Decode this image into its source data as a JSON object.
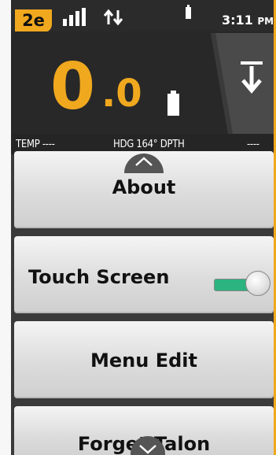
{
  "status": {
    "mode_badge": "2e",
    "time": "3:11",
    "ampm": "PM",
    "icons": [
      "signal-icon",
      "transfer-icon",
      "battery-icon"
    ]
  },
  "speed": {
    "integer": "0",
    "decimal": ".0"
  },
  "readings": {
    "temp": "TEMP ----",
    "hdg": "HDG 164° DPTH",
    "depth": "----"
  },
  "menu": {
    "items": [
      {
        "label": "About"
      },
      {
        "label": "Touch Screen",
        "toggle_on": true
      },
      {
        "label": "Menu Edit"
      },
      {
        "label": "Forget Talon"
      }
    ]
  },
  "colors": {
    "accent": "#f0a81e",
    "toggle_on": "#2bb47f",
    "panel": "#2b2b2b"
  }
}
